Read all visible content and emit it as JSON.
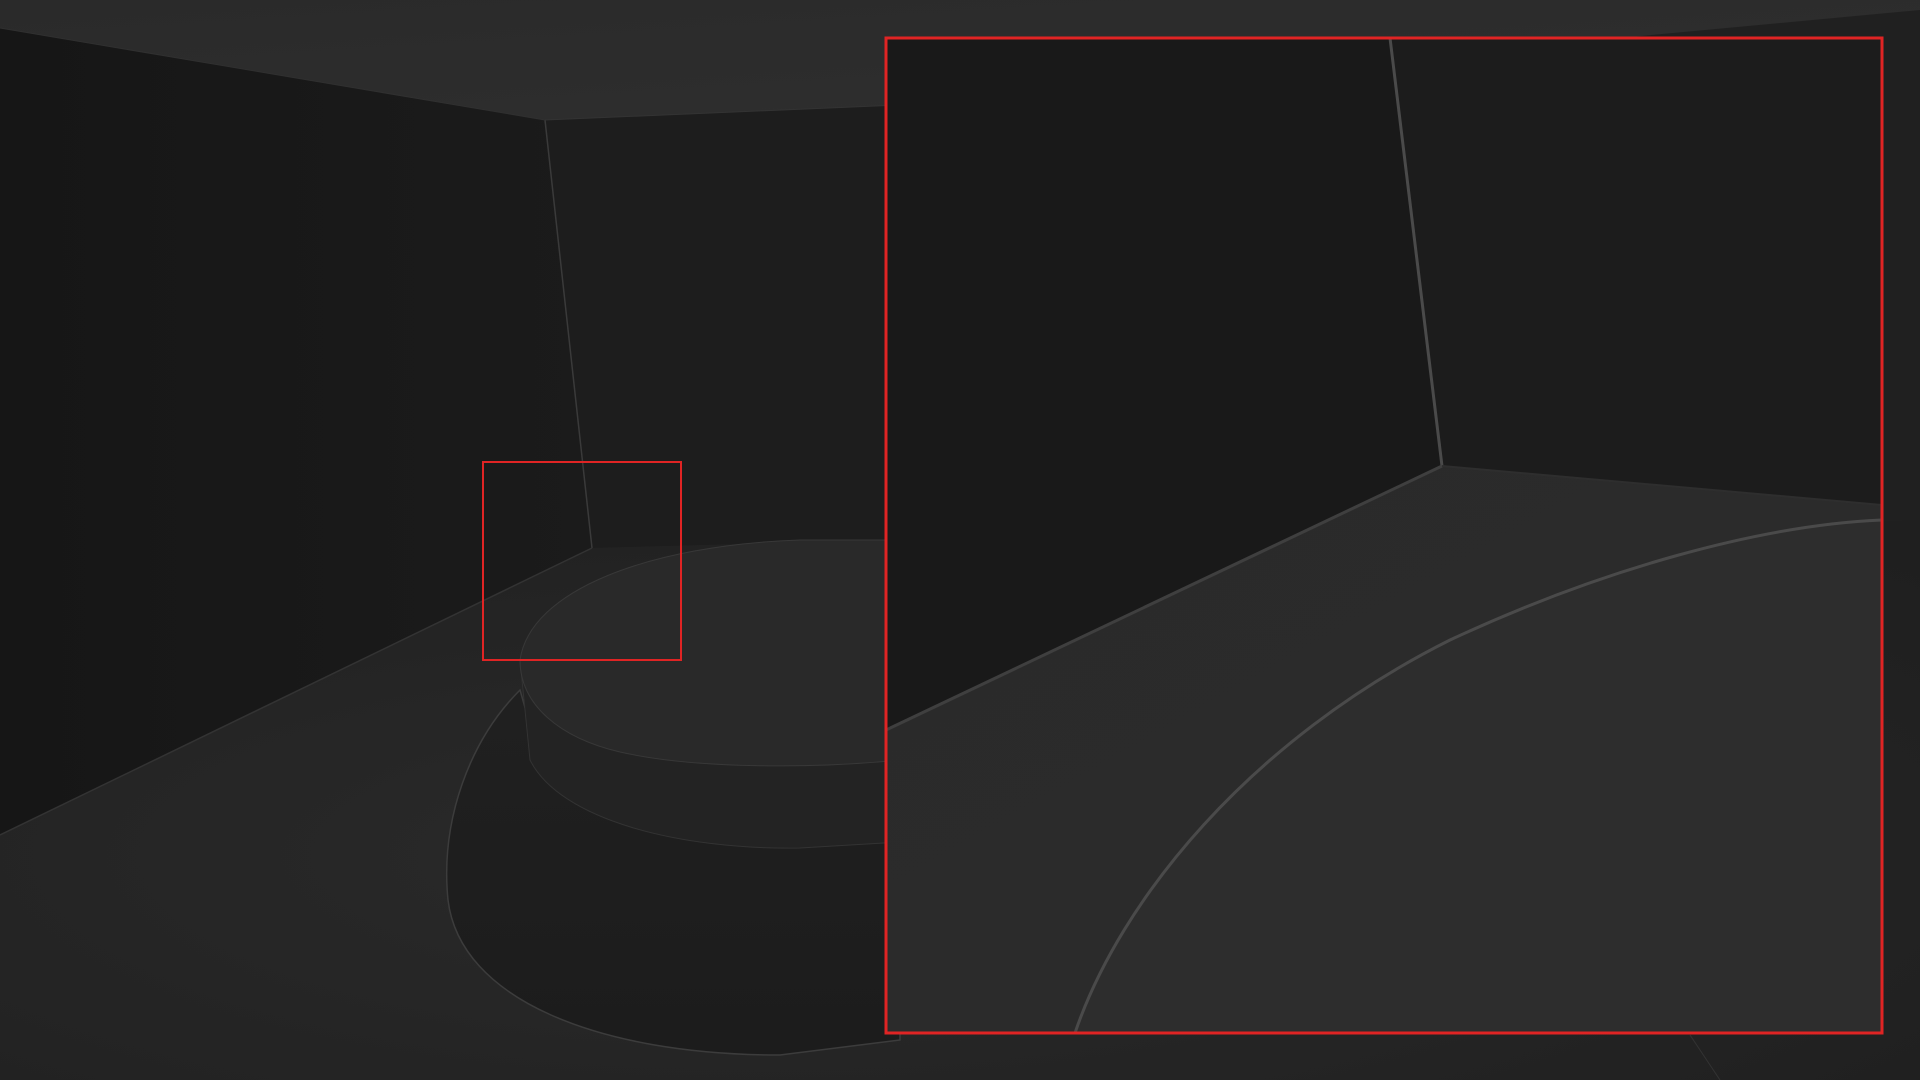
{
  "viewport": {
    "description_visible_text": "",
    "colors": {
      "background": "#202020",
      "ceiling": "#2b2b2b",
      "left_wall": "#191919",
      "back_wall": "#1d1d1d",
      "floor": "#262626",
      "edge": "#3a3a3a",
      "pedestal_top": "#2a2a2a",
      "pedestal_side": "#222222",
      "highlight_box": "#e02424"
    }
  }
}
